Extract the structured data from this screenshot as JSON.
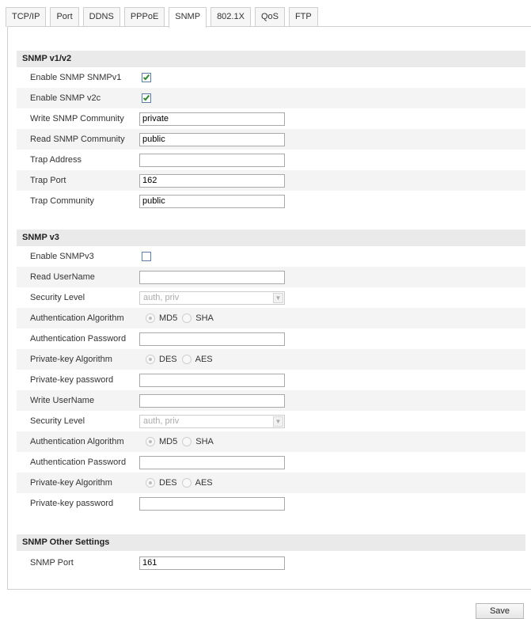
{
  "tabs": [
    {
      "label": "TCP/IP"
    },
    {
      "label": "Port"
    },
    {
      "label": "DDNS"
    },
    {
      "label": "PPPoE"
    },
    {
      "label": "SNMP"
    },
    {
      "label": "802.1X"
    },
    {
      "label": "QoS"
    },
    {
      "label": "FTP"
    }
  ],
  "active_tab": "SNMP",
  "snmp_v1v2": {
    "title": "SNMP v1/v2",
    "enable_v1": {
      "label": "Enable SNMP SNMPv1",
      "checked": true
    },
    "enable_v2c": {
      "label": "Enable SNMP v2c",
      "checked": true
    },
    "write_community": {
      "label": "Write SNMP Community",
      "value": "private"
    },
    "read_community": {
      "label": "Read SNMP Community",
      "value": "public"
    },
    "trap_address": {
      "label": "Trap Address",
      "value": ""
    },
    "trap_port": {
      "label": "Trap Port",
      "value": "162"
    },
    "trap_community": {
      "label": "Trap Community",
      "value": "public"
    }
  },
  "snmp_v3": {
    "title": "SNMP v3",
    "enable_v3": {
      "label": "Enable SNMPv3",
      "checked": false
    },
    "read_username": {
      "label": "Read UserName",
      "value": ""
    },
    "read_security_level": {
      "label": "Security Level",
      "value": "auth, priv"
    },
    "read_auth_algorithm": {
      "label": "Authentication Algorithm",
      "options": [
        "MD5",
        "SHA"
      ],
      "selected": "MD5"
    },
    "read_auth_password": {
      "label": "Authentication Password",
      "value": ""
    },
    "read_privkey_algorithm": {
      "label": "Private-key Algorithm",
      "options": [
        "DES",
        "AES"
      ],
      "selected": "DES"
    },
    "read_privkey_password": {
      "label": "Private-key password",
      "value": ""
    },
    "write_username": {
      "label": "Write UserName",
      "value": ""
    },
    "write_security_level": {
      "label": "Security Level",
      "value": "auth, priv"
    },
    "write_auth_algorithm": {
      "label": "Authentication Algorithm",
      "options": [
        "MD5",
        "SHA"
      ],
      "selected": "MD5"
    },
    "write_auth_password": {
      "label": "Authentication Password",
      "value": ""
    },
    "write_privkey_algorithm": {
      "label": "Private-key Algorithm",
      "options": [
        "DES",
        "AES"
      ],
      "selected": "DES"
    },
    "write_privkey_password": {
      "label": "Private-key password",
      "value": ""
    }
  },
  "snmp_other": {
    "title": "SNMP Other Settings",
    "snmp_port": {
      "label": "SNMP Port",
      "value": "161"
    }
  },
  "save_label": "Save",
  "icons": {
    "select_arrow": "chevron-down-icon",
    "checkbox_tick": "check-icon"
  }
}
